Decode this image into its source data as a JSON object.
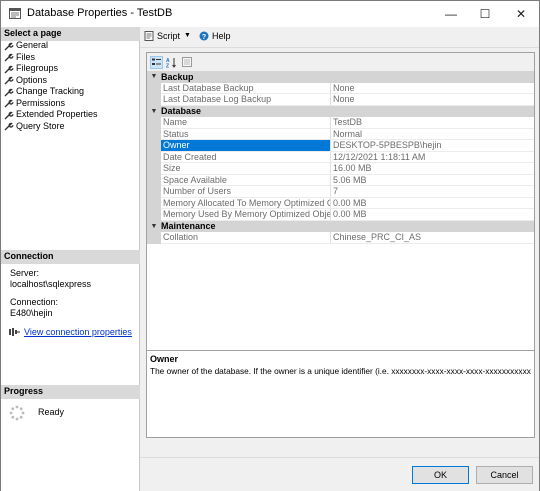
{
  "window": {
    "title": "Database Properties - TestDB"
  },
  "titlebar": {
    "min": "—",
    "max": "☐",
    "close": "✕"
  },
  "left": {
    "select_page_header": "Select a page",
    "pages": [
      {
        "label": "General"
      },
      {
        "label": "Files"
      },
      {
        "label": "Filegroups"
      },
      {
        "label": "Options"
      },
      {
        "label": "Change Tracking"
      },
      {
        "label": "Permissions"
      },
      {
        "label": "Extended Properties"
      },
      {
        "label": "Query Store"
      }
    ],
    "connection_header": "Connection",
    "server_label": "Server:",
    "server_value": "localhost\\sqlexpress",
    "connection_label": "Connection:",
    "connection_value": "E480\\hejin",
    "view_link": "View connection properties",
    "progress_header": "Progress",
    "progress_status": "Ready"
  },
  "toolbar": {
    "script_label": "Script",
    "help_label": "Help"
  },
  "grid": {
    "categories": [
      {
        "name": "Backup",
        "props": [
          {
            "name": "Last Database Backup",
            "value": "None"
          },
          {
            "name": "Last Database Log Backup",
            "value": "None"
          }
        ]
      },
      {
        "name": "Database",
        "props": [
          {
            "name": "Name",
            "value": "TestDB"
          },
          {
            "name": "Status",
            "value": "Normal"
          },
          {
            "name": "Owner",
            "value": "DESKTOP-5PBESPB\\hejin",
            "selected": true
          },
          {
            "name": "Date Created",
            "value": "12/12/2021 1:18:11 AM"
          },
          {
            "name": "Size",
            "value": "16.00 MB"
          },
          {
            "name": "Space Available",
            "value": "5.06 MB"
          },
          {
            "name": "Number of Users",
            "value": "7"
          },
          {
            "name": "Memory Allocated To Memory Optimized Obje",
            "value": "0.00 MB"
          },
          {
            "name": "Memory Used By Memory Optimized Objects",
            "value": "0.00 MB"
          }
        ]
      },
      {
        "name": "Maintenance",
        "props": [
          {
            "name": "Collation",
            "value": "Chinese_PRC_CI_AS"
          }
        ]
      }
    ],
    "description_title": "Owner",
    "description_text": "The owner of the database. If the owner is a unique identifier (i.e. xxxxxxxx-xxxx-xxxx-xxxx-xxxxxxxxxxxx)..."
  },
  "buttons": {
    "ok": "OK",
    "cancel": "Cancel"
  }
}
